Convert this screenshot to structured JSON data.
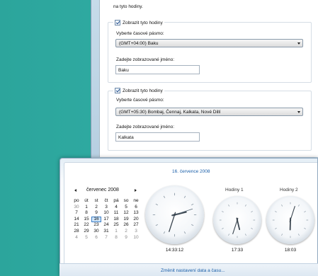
{
  "dialog": {
    "intro_text": "na tyto hodiny.",
    "clocks": [
      {
        "show_label": "Zobrazit tyto hodiny",
        "show_checked": true,
        "timezone_label": "Vyberte časové pásmo:",
        "timezone_value": "(GMT+04:00) Baku",
        "name_label": "Zadejte zobrazované jméno:",
        "name_value": "Baku"
      },
      {
        "show_label": "Zobrazit tyto hodiny",
        "show_checked": true,
        "timezone_label": "Vyberte časové pásmo:",
        "timezone_value": "(GMT+05:30) Bombaj, Čennaj, Kalkata, Nové Dillí",
        "name_label": "Zadejte zobrazované jméno:",
        "name_value": "Kalkata"
      }
    ]
  },
  "popup": {
    "date_header": "16. července 2008",
    "change_link": "Změnit nastavení data a času...",
    "calendar": {
      "month_label": "červenec 2008",
      "weekdays": [
        "po",
        "út",
        "st",
        "čt",
        "pá",
        "so",
        "ne"
      ],
      "weeks": [
        [
          "30",
          "1",
          "2",
          "3",
          "4",
          "5",
          "6"
        ],
        [
          "7",
          "8",
          "9",
          "10",
          "11",
          "12",
          "13"
        ],
        [
          "14",
          "15",
          "16",
          "17",
          "18",
          "19",
          "20"
        ],
        [
          "21",
          "22",
          "23",
          "24",
          "25",
          "26",
          "27"
        ],
        [
          "28",
          "29",
          "30",
          "31",
          "1",
          "2",
          "3"
        ],
        [
          "4",
          "5",
          "6",
          "7",
          "8",
          "9",
          "10"
        ]
      ],
      "selected_day": "16"
    },
    "clocks": [
      {
        "name": "",
        "time": "14:33:12",
        "hour": 14,
        "minute": 33,
        "second": 12
      },
      {
        "name": "Hodiny 1",
        "time": "17:33",
        "hour": 17,
        "minute": 33,
        "second": null
      },
      {
        "name": "Hodiny 2",
        "time": "18:03",
        "hour": 18,
        "minute": 3,
        "second": null
      }
    ]
  },
  "colors": {
    "desktop": "#2eaaa1",
    "link": "#1a5fa9",
    "today_highlight": "#cfe6fb"
  }
}
